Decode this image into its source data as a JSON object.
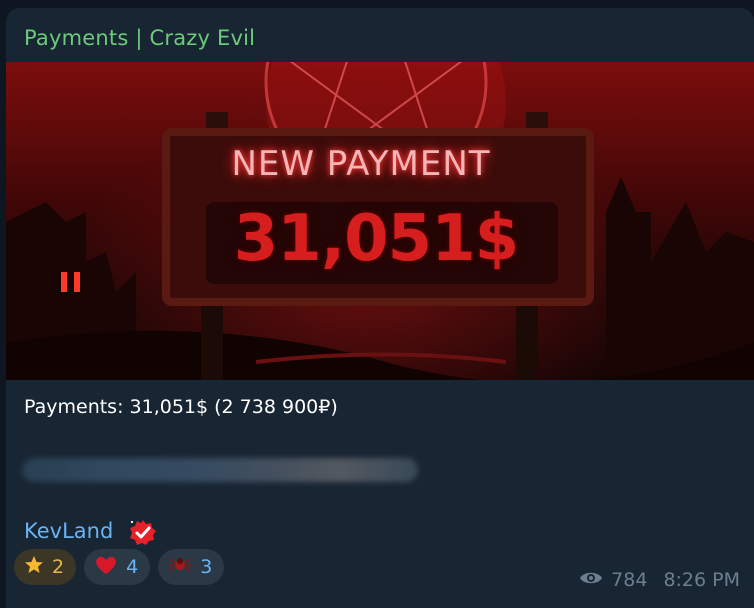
{
  "post": {
    "channel_title": "Payments | Crazy Evil",
    "banner": {
      "headline": "NEW PAYMENT",
      "amount": "31,051$"
    },
    "message": "Payments: 31,051$ (2 738 900₽)",
    "author": "KevLand",
    "reactions": [
      {
        "icon": "star-icon",
        "count": "2"
      },
      {
        "icon": "heart-icon",
        "count": "4"
      },
      {
        "icon": "spider-icon",
        "count": "3"
      }
    ],
    "views": "784",
    "time": "8:26 PM"
  },
  "colors": {
    "bubble": "#182533",
    "channel_title": "#6ccb79",
    "link": "#6ab3f3",
    "meta": "#6d7f8f",
    "banner_red": "#d61e1e"
  }
}
